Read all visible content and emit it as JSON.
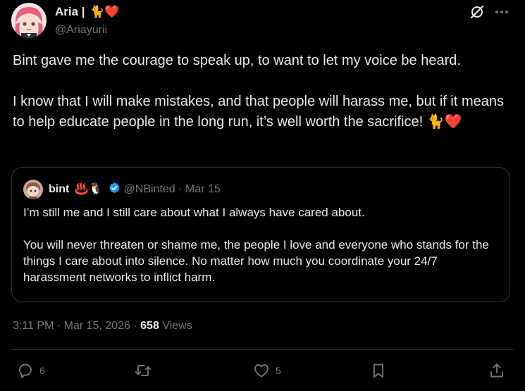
{
  "author": {
    "display_name": "Aria |",
    "name_emojis": "🐈❤️",
    "handle": "@Ariayurii"
  },
  "post": {
    "paragraphs": [
      "Bint gave me the courage to speak up, to want to let my voice be heard.",
      "I know that I will make mistakes, and that people will harass me, but if it means to help educate people in the long run, it’s well worth the sacrifice! 🐈❤️"
    ]
  },
  "quote": {
    "display_name": "bint",
    "name_emojis": "♨️🐧",
    "handle": "@NBinted",
    "separator": "·",
    "date": "Mar 15",
    "paragraphs": [
      "I’m still me and I still care about what I always have cared about.",
      "You will never threaten or shame me, the people I love and everyone who stands for the things I care about into silence. No matter how much you coordinate your 24/7 harassment networks to inflict harm."
    ]
  },
  "meta": {
    "time": "3:11 PM",
    "separator1": "·",
    "date": "Mar 15, 2026",
    "separator2": "·",
    "views_count": "658",
    "views_label": "Views"
  },
  "actions": {
    "reply_count": "6",
    "repost_count": "",
    "like_count": "5"
  },
  "icons": {
    "header": [
      "grok-icon",
      "more-icon"
    ],
    "actions": [
      "reply-icon",
      "repost-icon",
      "like-icon",
      "bookmark-icon",
      "share-icon"
    ]
  },
  "colors": {
    "background": "#000000",
    "text": "#e7e9ea",
    "secondary_text": "#71767b",
    "border": "#2f3336",
    "verified": "#1d9bf0"
  }
}
